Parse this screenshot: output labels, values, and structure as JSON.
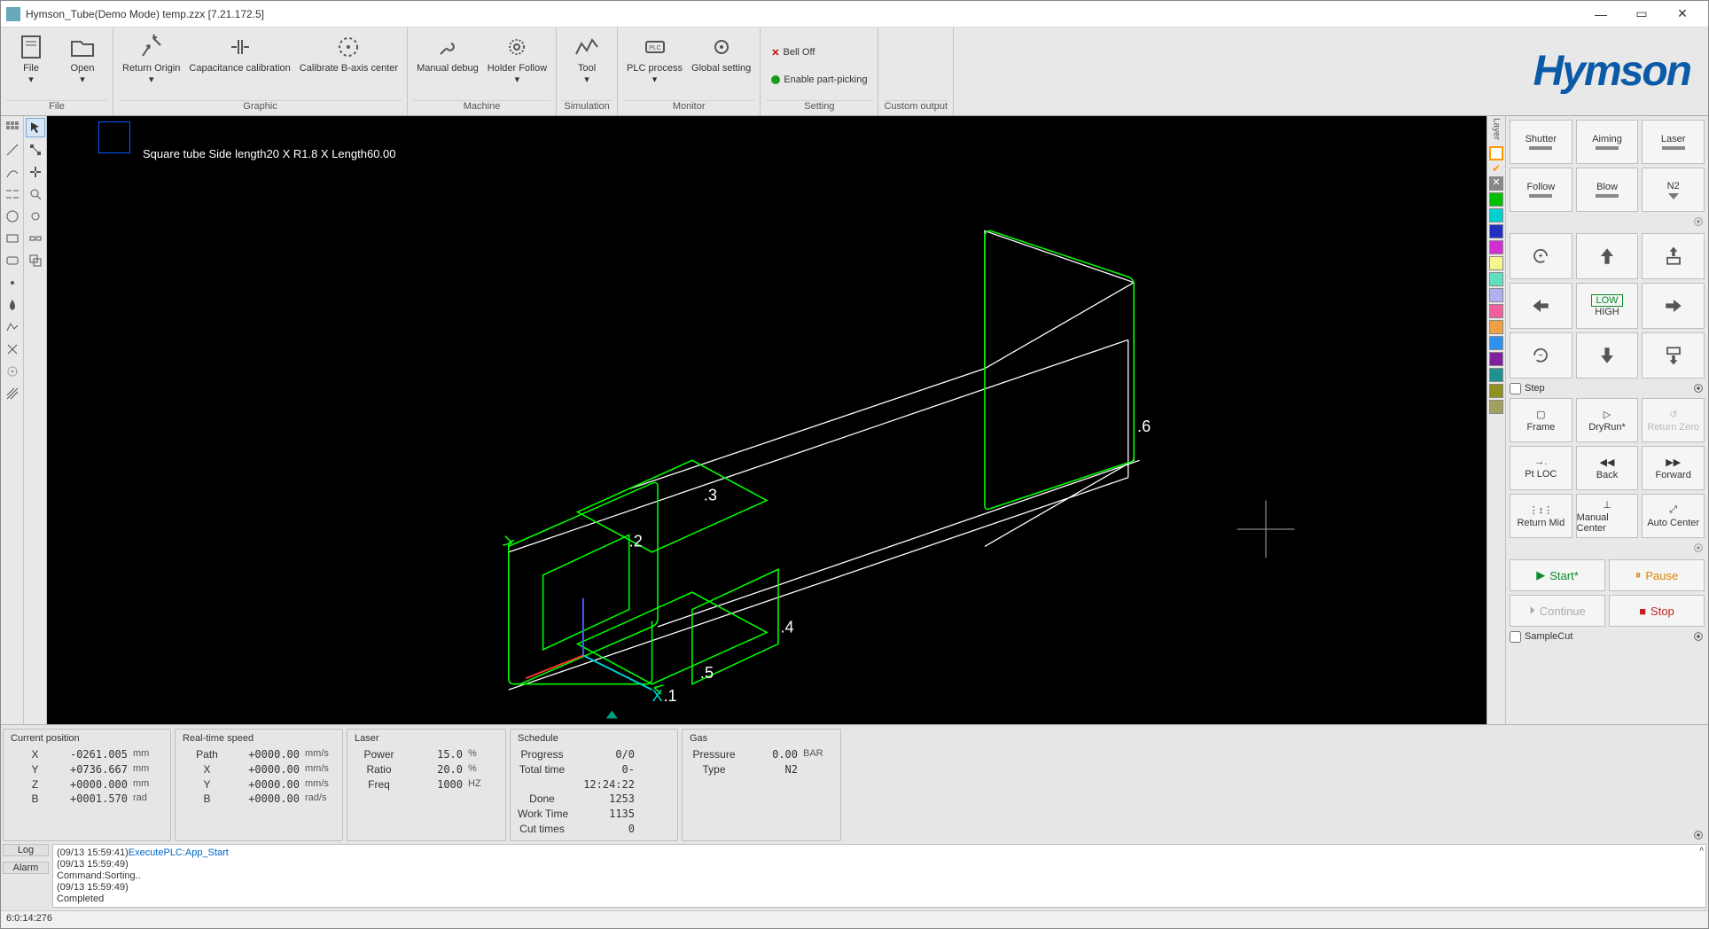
{
  "title": "Hymson_Tube(Demo Mode) temp.zzx   [7.21.172.5]",
  "ribbon": {
    "file": {
      "label": "File",
      "items": [
        {
          "l": "File"
        },
        {
          "l": "Open"
        }
      ]
    },
    "graphic": {
      "label": "Graphic",
      "items": [
        {
          "l": "Return Origin"
        },
        {
          "l": "Capacitance calibration"
        },
        {
          "l": "Calibrate B-axis center"
        }
      ]
    },
    "machine": {
      "label": "Machine",
      "items": [
        {
          "l": "Manual debug"
        },
        {
          "l": "Holder Follow"
        }
      ]
    },
    "simulation": {
      "label": "Simulation",
      "items": [
        {
          "l": "Tool"
        }
      ]
    },
    "monitor": {
      "label": "Monitor",
      "items": [
        {
          "l": "PLC process"
        },
        {
          "l": "Global setting"
        }
      ]
    },
    "setting": {
      "label": "Setting",
      "bell": "Bell Off",
      "pick": "Enable part-picking"
    },
    "custom": {
      "label": "Custom output"
    }
  },
  "brand": "Hymson",
  "canvas": {
    "info": "Square tube Side length20 X R1.8 X Length60.00"
  },
  "status": {
    "pos": {
      "hd": "Current position",
      "X": "-0261.005",
      "Y": "+0736.667",
      "Z": "+0000.000",
      "B": "+0001.570",
      "u": {
        "lin": "mm",
        "ang": "rad"
      }
    },
    "speed": {
      "hd": "Real-time speed",
      "Path": "+0000.00",
      "X": "+0000.00",
      "Y": "+0000.00",
      "B": "+0000.00",
      "u": {
        "lin": "mm/s",
        "ang": "rad/s"
      }
    },
    "laser": {
      "hd": "Laser",
      "Power": "15.0",
      "Ratio": "20.0",
      "Freq": "1000",
      "u": {
        "pr": "%",
        "hz": "HZ"
      }
    },
    "sched": {
      "hd": "Schedule",
      "Progress": "0/0",
      "Total time": "0-12:24:22",
      "Done": "1253",
      "Work Time": "1135",
      "Cut times": "0"
    },
    "gas": {
      "hd": "Gas",
      "Pressure": "0.00",
      "Type": "N2",
      "u": "BAR"
    }
  },
  "log": {
    "tab1": "Log",
    "tab2": "Alarm",
    "lines": "(09/13 15:59:41)ExecutePLC:App_Start\n(09/13 15:59:49)\nCommand:Sorting..\n(09/13 15:59:49)\nCompleted"
  },
  "foot": "6:0:14:276",
  "right": {
    "row1": [
      "Shutter",
      "Aiming",
      "Laser"
    ],
    "row2": [
      "Follow",
      "Blow",
      "N2"
    ],
    "lowhigh": {
      "a": "LOW",
      "b": "HIGH"
    },
    "step": "Step",
    "row4": [
      "Frame",
      "DryRun*",
      "Return Zero"
    ],
    "row5": [
      "Pt LOC",
      "Back",
      "Forward"
    ],
    "row6": [
      "Return Mid",
      "Manual Center",
      "Auto Center"
    ],
    "actions": {
      "start": "Start*",
      "pause": "Pause",
      "cont": "Continue",
      "stop": "Stop"
    },
    "sample": "SampleCut"
  },
  "layer_colors": [
    "#fff",
    "#ff8c00",
    "#ff8c00",
    "#fff",
    "#00c000",
    "#00d0d0",
    "#2030c0",
    "#d030d0",
    "#f5f590",
    "#60e0c0",
    "#b0b0f0",
    "#f060a0",
    "#f0a040",
    "#3090f0",
    "#8020a0",
    "#209090",
    "#909020",
    "#a0a060"
  ]
}
